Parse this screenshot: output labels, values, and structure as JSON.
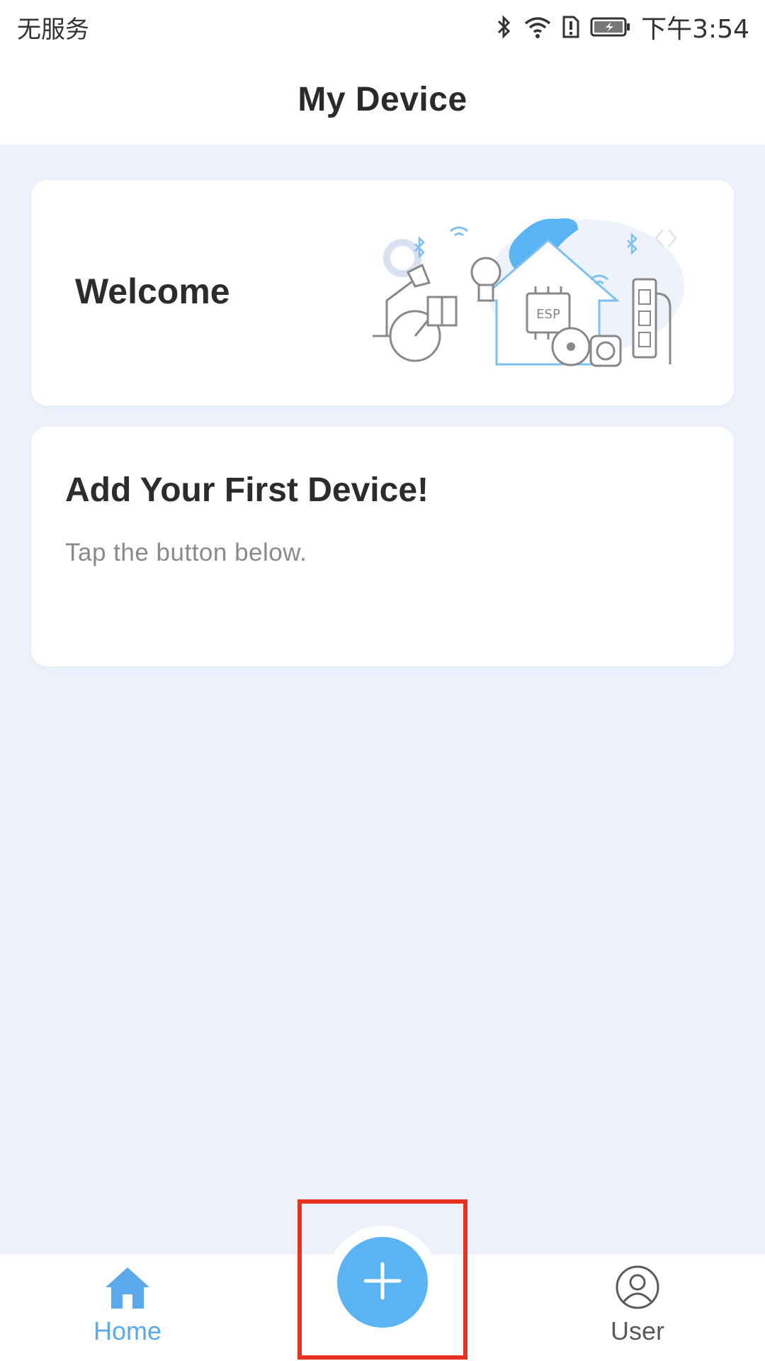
{
  "status_bar": {
    "carrier": "无服务",
    "time": "下午3:54"
  },
  "header": {
    "title": "My Device"
  },
  "welcome_card": {
    "title": "Welcome",
    "chip_label": "ESP"
  },
  "first_device_card": {
    "title": "Add Your First Device!",
    "subtitle": "Tap the button below."
  },
  "bottom_nav": {
    "home_label": "Home",
    "user_label": "User",
    "add_button_icon": "plus-icon",
    "home_icon": "home-icon",
    "user_icon": "user-icon"
  },
  "colors": {
    "accent": "#5ab4f3",
    "background": "#edf1fc",
    "highlight_border": "#e8321f"
  }
}
